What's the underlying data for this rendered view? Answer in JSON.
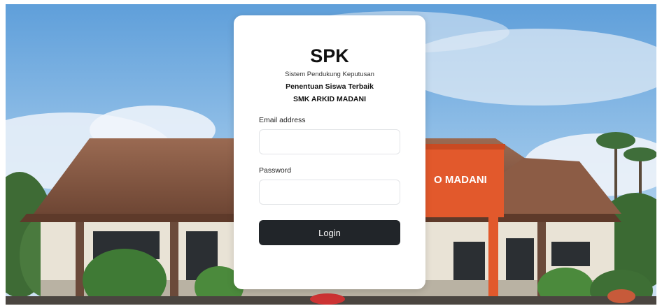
{
  "app": {
    "title": "SPK",
    "subtitle": "Sistem Pendukung Keputusan",
    "heading_line1": "Penentuan Siswa Terbaik",
    "heading_line2": "SMK ARKID MADANI"
  },
  "building_sign": "O MADANI",
  "form": {
    "email_label": "Email address",
    "email_value": "",
    "password_label": "Password",
    "password_value": "",
    "login_label": "Login"
  },
  "colors": {
    "button_bg": "#212529",
    "sky": "#7fb2df",
    "roof": "#8a5a43",
    "sign": "#e2592c"
  }
}
